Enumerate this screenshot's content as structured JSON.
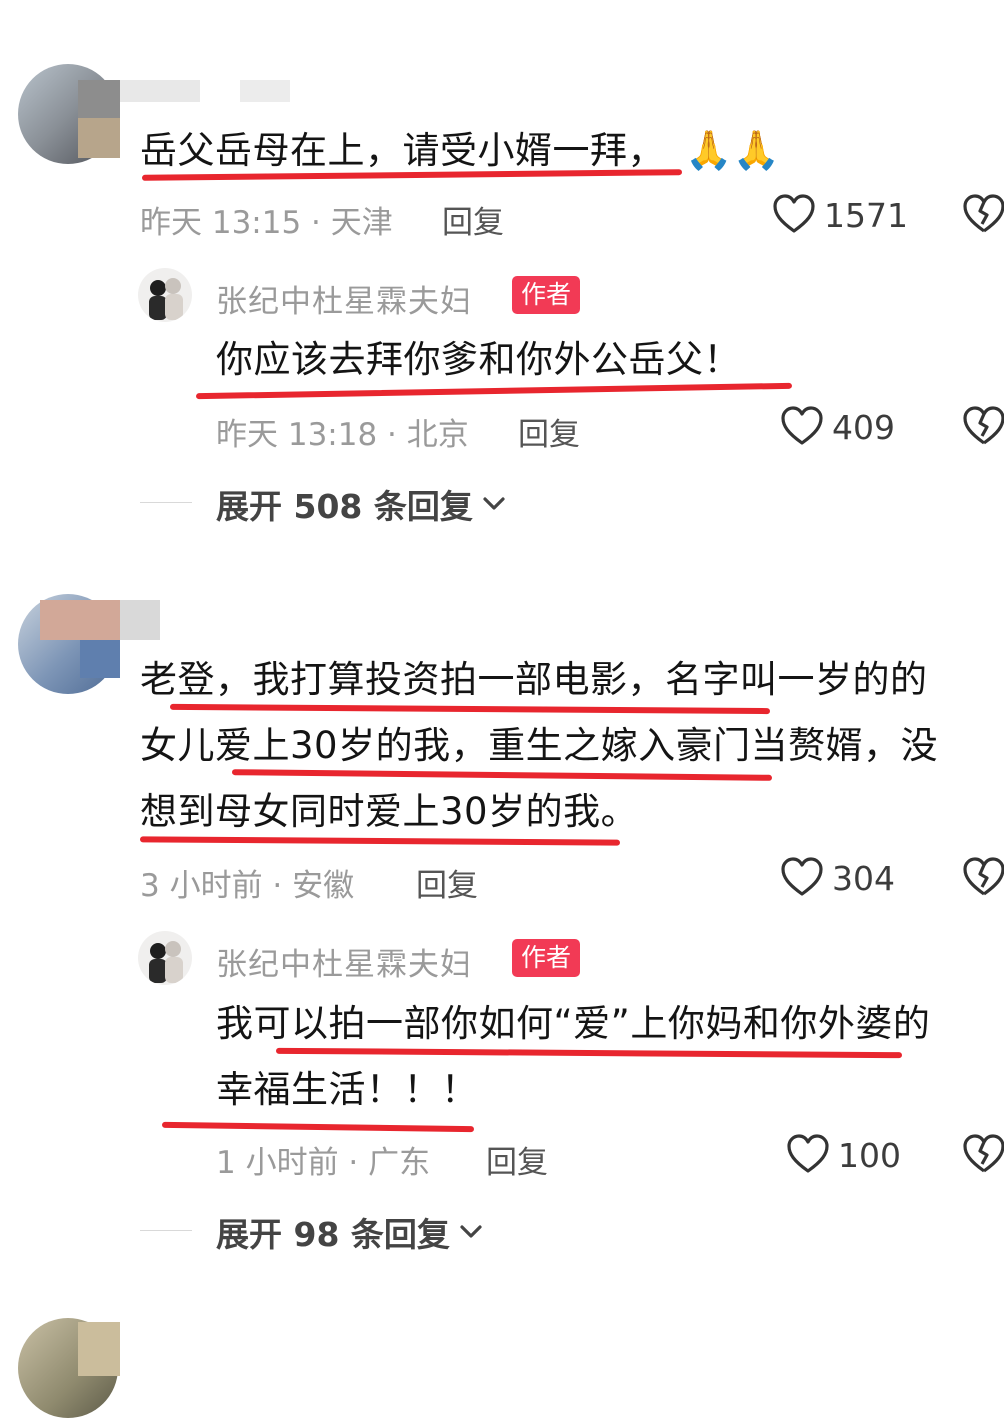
{
  "comments": [
    {
      "text_lines": [
        "岳父岳母在上，请受小婿一拜，"
      ],
      "emoji": "🙏🙏",
      "time": "昨天 13:15",
      "location": "天津",
      "meta": "昨天 13:15 · 天津",
      "reply_label": "回复",
      "likes": "1571",
      "reply": {
        "author": "张纪中杜星霖夫妇",
        "badge": "作者",
        "text_lines": [
          "你应该去拜你爹和你外公岳父！"
        ],
        "meta": "昨天 13:18 · 北京",
        "reply_label": "回复",
        "likes": "409"
      },
      "expand_label": "展开 508 条回复"
    },
    {
      "text_lines": [
        "老登，我打算投资拍一部电影，名字叫一岁的的",
        "女儿爱上30岁的我，重生之嫁入豪门当赘婿，没",
        "想到母女同时爱上30岁的我。"
      ],
      "meta": "3 小时前 · 安徽",
      "reply_label": "回复",
      "likes": "304",
      "reply": {
        "author": "张纪中杜星霖夫妇",
        "badge": "作者",
        "text_lines": [
          "我可以拍一部你如何“爱”上你妈和你外婆的",
          "幸福生活！！！"
        ],
        "meta": "1 小时前 · 广东",
        "reply_label": "回复",
        "likes": "100"
      },
      "expand_label": "展开 98 条回复"
    }
  ],
  "colors": {
    "highlight": "#e8262e",
    "badge": "#f23a55"
  },
  "icons": {
    "like": "heart-outline-icon",
    "dislike": "broken-heart-icon",
    "expand": "chevron-down-icon"
  }
}
